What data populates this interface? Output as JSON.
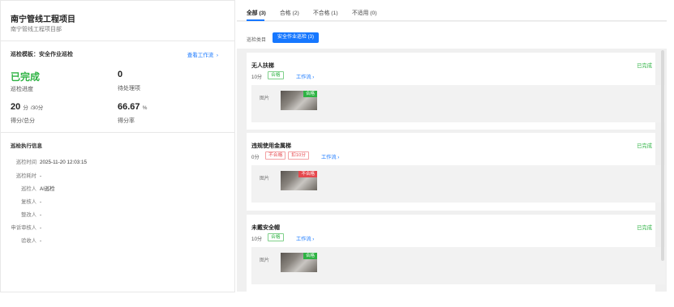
{
  "project": {
    "title": "南宁管线工程项目",
    "subtitle": "南宁管线工程项目部"
  },
  "template": {
    "label": "巡检模板：安全作业巡检",
    "link": "查看工作流",
    "link_icon": "chevron-right-icon"
  },
  "stats": {
    "progress_value": "已完成",
    "progress_label": "巡检进度",
    "pending_value": "0",
    "pending_label": "待处理项",
    "score_value": "20",
    "score_unit": "分",
    "score_total": "/30分",
    "score_label": "得分/总分",
    "rate_value": "66.67",
    "rate_unit": "%",
    "rate_label": "得分率"
  },
  "exec": {
    "title": "巡检执行信息",
    "rows": [
      {
        "key": "巡检时间",
        "val": "2025-11-20 12:03:15"
      },
      {
        "key": "巡检耗时",
        "val": "-"
      },
      {
        "key": "巡检人",
        "val": "AI巡检"
      },
      {
        "key": "复核人",
        "val": "-"
      },
      {
        "key": "整改人",
        "val": "-"
      },
      {
        "key": "申诉审核人",
        "val": "-"
      },
      {
        "key": "验收人",
        "val": "-"
      }
    ]
  },
  "tabs": [
    {
      "label": "全部 (3)"
    },
    {
      "label": "合格 (2)"
    },
    {
      "label": "不合格 (1)"
    },
    {
      "label": "不适用 (0)"
    }
  ],
  "category": {
    "label": "巡检类目",
    "button": "安全作业巡检 (3)"
  },
  "items": [
    {
      "title": "无人扶梯",
      "status": "已完成",
      "score": "10分",
      "tags": [
        "合格"
      ],
      "flow": "工作流",
      "image_label": "图片",
      "thumb_badge": "合格"
    },
    {
      "title": "违规使用金属梯",
      "status": "已完成",
      "score": "0分",
      "tags": [
        "不合格",
        "扣10分"
      ],
      "flow": "工作流",
      "image_label": "图片",
      "thumb_badge": "不合格"
    },
    {
      "title": "未戴安全帽",
      "status": "已完成",
      "score": "10分",
      "tags": [
        "合格"
      ],
      "flow": "工作流",
      "image_label": "图片",
      "thumb_badge": "合格"
    }
  ],
  "colors": {
    "accent": "#1677ff",
    "success": "#2fb344",
    "danger": "#e5484d"
  }
}
